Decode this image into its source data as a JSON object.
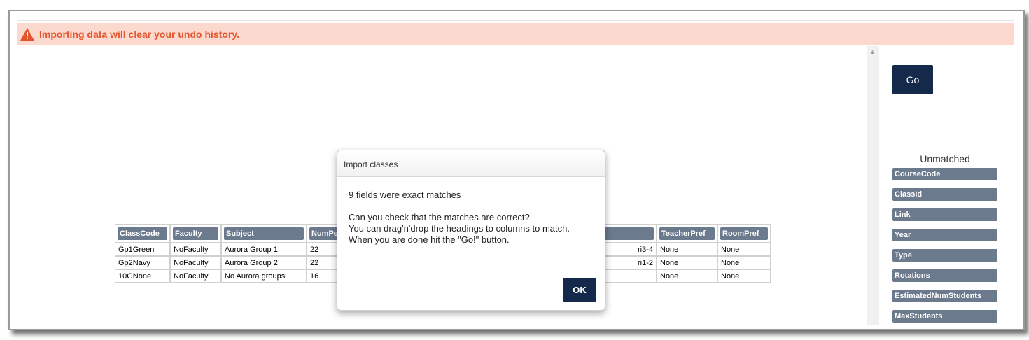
{
  "warning": {
    "text": "Importing data will clear your undo history."
  },
  "right_panel": {
    "go_label": "Go",
    "unmatched_title": "Unmatched",
    "unmatched_items": [
      "CourseCode",
      "ClassId",
      "Link",
      "Year",
      "Type",
      "Rotations",
      "EstimatedNumStudents",
      "MaxStudents"
    ]
  },
  "table": {
    "headers": [
      "ClassCode",
      "Faculty",
      "Subject",
      "NumPe",
      "",
      "TeacherPref",
      "RoomPref"
    ],
    "rows": [
      [
        "Gp1Green",
        "NoFaculty",
        "Aurora Group 1",
        "22",
        "ri3-4",
        "None",
        "None"
      ],
      [
        "Gp2Navy",
        "NoFaculty",
        "Aurora Group 2",
        "22",
        "ri1-2",
        "None",
        "None"
      ],
      [
        "10GNone",
        "NoFaculty",
        "No Aurora groups",
        "16",
        "",
        "None",
        "None"
      ]
    ]
  },
  "modal": {
    "title": "Import classes",
    "heading": "9 fields were exact matches",
    "line1": "Can you check that the matches are correct?",
    "line2": "You can drag'n'drop the headings to columns to match.",
    "line3": "When you are done hit the \"Go!\" button.",
    "ok_label": "OK"
  },
  "colors": {
    "accent": "#152a4a",
    "chip": "#6c7a8e",
    "warning_bg": "#fbd9cf",
    "warning_text": "#e4572e"
  }
}
